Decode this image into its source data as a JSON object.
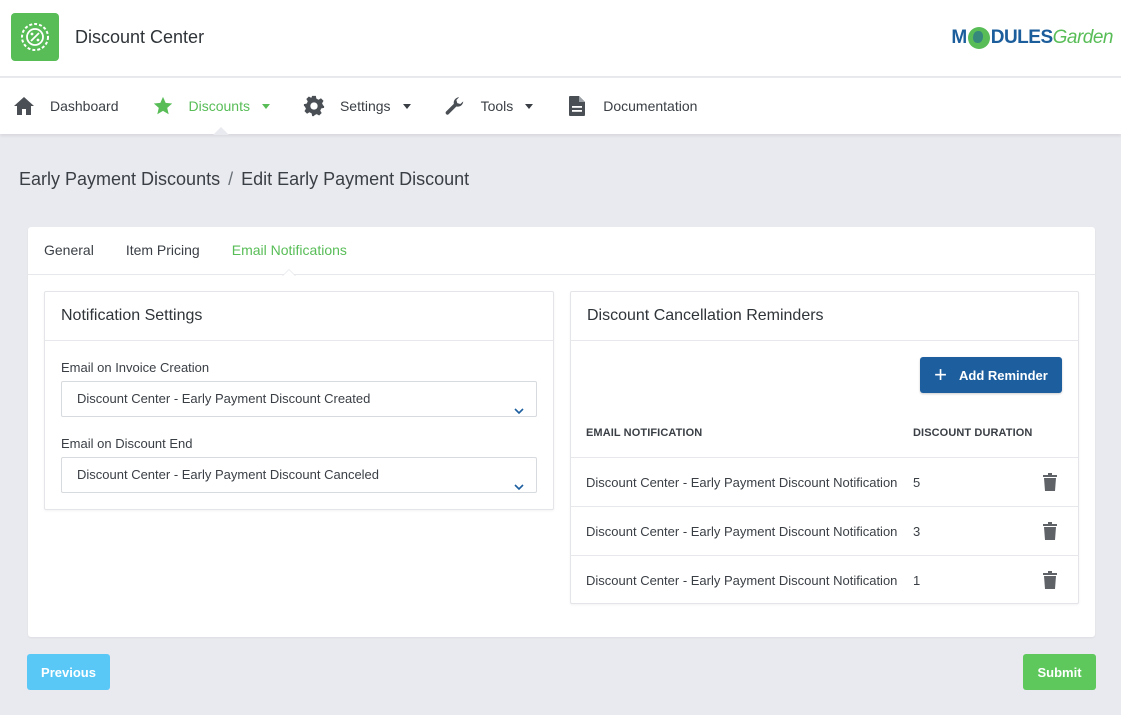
{
  "header": {
    "app_title": "Discount Center",
    "brand_part1": "M",
    "brand_part2": "DULES",
    "brand_part3": "Garden",
    "accent_color": "#58bd57",
    "brand_color": "#1c5d9c"
  },
  "nav": {
    "items": [
      {
        "label": "Dashboard",
        "icon": "home-icon"
      },
      {
        "label": "Discounts",
        "icon": "star-icon",
        "active": true,
        "dropdown": true
      },
      {
        "label": "Settings",
        "icon": "gear-icon",
        "dropdown": true
      },
      {
        "label": "Tools",
        "icon": "wrench-icon",
        "dropdown": true
      },
      {
        "label": "Documentation",
        "icon": "document-icon"
      }
    ]
  },
  "breadcrumb": {
    "parent": "Early Payment Discounts",
    "separator": "/",
    "current": "Edit Early Payment Discount"
  },
  "tabs": [
    {
      "label": "General"
    },
    {
      "label": "Item Pricing"
    },
    {
      "label": "Email Notifications",
      "active": true
    }
  ],
  "notification_settings": {
    "title": "Notification Settings",
    "invoice_creation_label": "Email on Invoice Creation",
    "invoice_creation_value": "Discount Center - Early Payment Discount Created",
    "discount_end_label": "Email on Discount End",
    "discount_end_value": "Discount Center - Early Payment Discount Canceled"
  },
  "reminders": {
    "title": "Discount Cancellation Reminders",
    "add_label": "Add Reminder",
    "col_notification": "EMAIL NOTIFICATION",
    "col_duration": "DISCOUNT DURATION",
    "rows": [
      {
        "notification": "Discount Center - Early Payment Discount Notification",
        "duration": "5"
      },
      {
        "notification": "Discount Center - Early Payment Discount Notification",
        "duration": "3"
      },
      {
        "notification": "Discount Center - Early Payment Discount Notification",
        "duration": "1"
      }
    ]
  },
  "footer": {
    "previous_label": "Previous",
    "submit_label": "Submit"
  }
}
